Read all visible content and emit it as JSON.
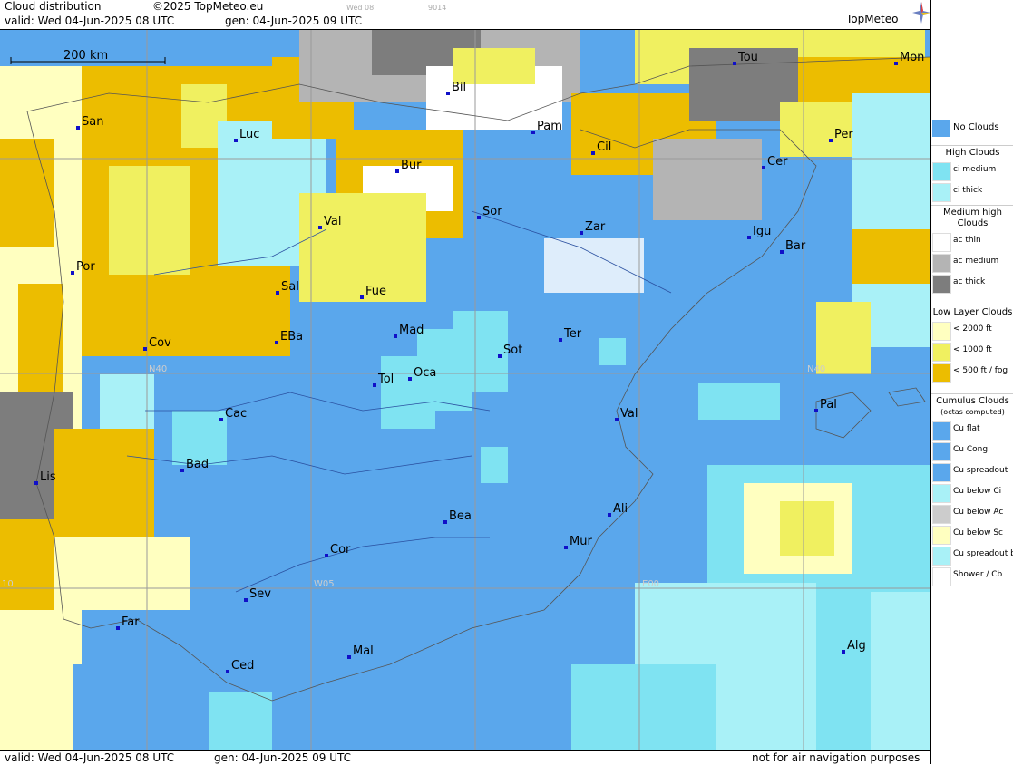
{
  "header": {
    "title": "Cloud distribution",
    "copyright": "©2025 TopMeteo.eu",
    "valid": "valid:  Wed  04-Jun-2025  08 UTC",
    "gen": "gen: 04-Jun-2025 09 UTC",
    "mini_day": "Wed 08",
    "mini_code": "9014",
    "brand": "TopMeteo"
  },
  "footer": {
    "valid": "valid:  Wed  04-Jun-2025  08 UTC",
    "gen": "gen: 04-Jun-2025 09 UTC",
    "note": "not for air navigation purposes"
  },
  "map": {
    "scale_label": "200 km",
    "grid_labels": [
      "N40",
      "N40",
      "W05",
      "E00",
      "10"
    ],
    "colors": {
      "sea_land_clear": "#5aa7ec",
      "ci_medium": "#7fe3f2",
      "ci_thick": "#a9f1f7",
      "ac_thin": "#ffffff",
      "ac_medium": "#b4b4b4",
      "ac_thick": "#7d7d7d",
      "low_2000": "#ffffc0",
      "low_1000": "#f0f060",
      "low_500": "#ecbd00",
      "city_dot": "#1010c8"
    },
    "cities": [
      {
        "name": "San"
      },
      {
        "name": "Luc"
      },
      {
        "name": "Bil"
      },
      {
        "name": "Pam"
      },
      {
        "name": "Tou"
      },
      {
        "name": "Mon"
      },
      {
        "name": "Per"
      },
      {
        "name": "Cil"
      },
      {
        "name": "Bur"
      },
      {
        "name": "Cer"
      },
      {
        "name": "Sor"
      },
      {
        "name": "Val"
      },
      {
        "name": "Zar"
      },
      {
        "name": "Igu"
      },
      {
        "name": "Bar"
      },
      {
        "name": "Por"
      },
      {
        "name": "Sal"
      },
      {
        "name": "Fue"
      },
      {
        "name": "Mad"
      },
      {
        "name": "Cov"
      },
      {
        "name": "EBa"
      },
      {
        "name": "Sot"
      },
      {
        "name": "Ter"
      },
      {
        "name": "Tol"
      },
      {
        "name": "Oca"
      },
      {
        "name": "Pal"
      },
      {
        "name": "Cac"
      },
      {
        "name": "Val"
      },
      {
        "name": "Bad"
      },
      {
        "name": "Lis"
      },
      {
        "name": "Ali"
      },
      {
        "name": "Bea"
      },
      {
        "name": "Mur"
      },
      {
        "name": "Cor"
      },
      {
        "name": "Sev"
      },
      {
        "name": "Far"
      },
      {
        "name": "Alg"
      },
      {
        "name": "Mal"
      },
      {
        "name": "Ced"
      }
    ]
  },
  "legend": {
    "no_clouds": "No Clouds",
    "high_head": "High Clouds",
    "high": [
      {
        "label": "ci medium",
        "color": "#7fe3f2"
      },
      {
        "label": "ci thick",
        "color": "#a9f1f7"
      }
    ],
    "medium_head": "Medium high Clouds",
    "medium": [
      {
        "label": "ac thin",
        "color": "#ffffff"
      },
      {
        "label": "ac medium",
        "color": "#b4b4b4"
      },
      {
        "label": "ac thick",
        "color": "#7d7d7d"
      }
    ],
    "low_head": "Low Layer Clouds",
    "low": [
      {
        "label": "< 2000 ft",
        "color": "#ffffc0"
      },
      {
        "label": "< 1000 ft",
        "color": "#f0f060"
      },
      {
        "label": "< 500 ft / fog",
        "color": "#ecbd00"
      }
    ],
    "cu_head": "Cumulus Clouds",
    "cu_sub": "(octas computed)",
    "cu": [
      {
        "label": "Cu flat",
        "color": "#5aa7ec"
      },
      {
        "label": "Cu Cong",
        "color": "#5aa7ec"
      },
      {
        "label": "Cu spreadout",
        "color": "#5aa7ec"
      },
      {
        "label": "Cu below Ci",
        "color": "#a9f1f7"
      },
      {
        "label": "Cu below Ac",
        "color": "#cccccc"
      },
      {
        "label": "Cu below Sc",
        "color": "#ffffc0"
      },
      {
        "label": "Cu spreadout below Ci",
        "color": "#a9f1f7"
      },
      {
        "label": "Shower / Cb",
        "color": "#ffffff"
      }
    ]
  }
}
